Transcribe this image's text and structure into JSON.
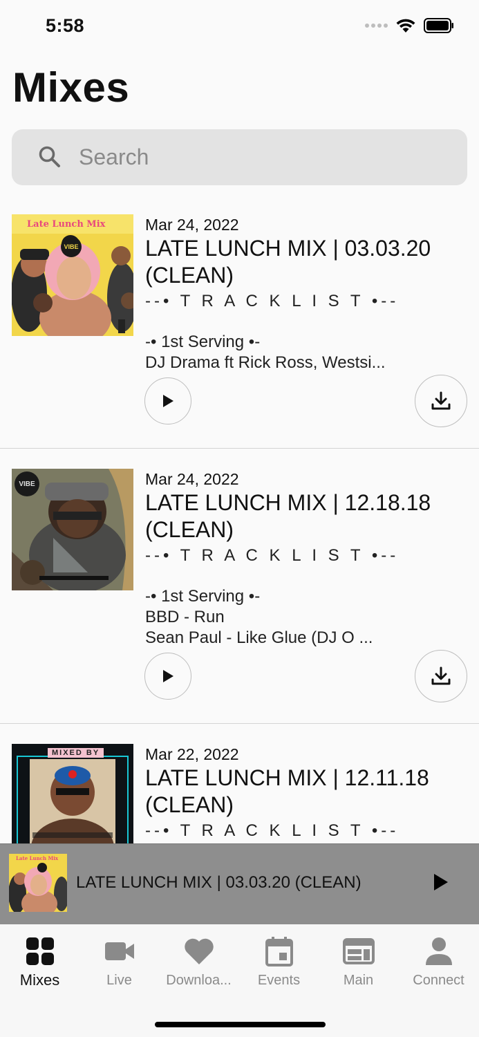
{
  "status_bar": {
    "time": "5:58"
  },
  "page": {
    "title": "Mixes"
  },
  "search": {
    "placeholder": "Search"
  },
  "mixes": [
    {
      "date": "Mar 24, 2022",
      "title": "LATE LUNCH MIX | 03.03.20 (CLEAN)",
      "tracklist": "--• T R A C K L I S T •--",
      "lines": [
        "-• 1st Serving •-",
        "DJ Drama ft Rick Ross, Westsi..."
      ],
      "cover_text": "Late Lunch Mix",
      "cover_badge": "VIBE"
    },
    {
      "date": "Mar 24, 2022",
      "title": "LATE LUNCH MIX | 12.18.18 (CLEAN)",
      "tracklist": "--• T R A C K L I S T •--",
      "lines": [
        "-• 1st Serving •-",
        "BBD - Run",
        "Sean Paul - Like Glue (DJ O ..."
      ],
      "cover_badge": "VIBE"
    },
    {
      "date": "Mar 22, 2022",
      "title": "LATE LUNCH MIX | 12.11.18 (CLEAN)",
      "tracklist": "--• T R A C K L I S T •--",
      "lines": [],
      "cover_text": "MIXED BY"
    }
  ],
  "now_playing": {
    "title": "LATE LUNCH MIX | 03.03.20 (CLEAN)",
    "cover_text": "Late Lunch Mix"
  },
  "tabs": [
    {
      "label": "Mixes",
      "icon": "grid-icon",
      "active": true
    },
    {
      "label": "Live",
      "icon": "video-camera-icon"
    },
    {
      "label": "Downloa...",
      "icon": "heart-icon"
    },
    {
      "label": "Events",
      "icon": "calendar-icon"
    },
    {
      "label": "Main",
      "icon": "browser-window-icon"
    },
    {
      "label": "Connect",
      "icon": "person-icon"
    }
  ],
  "colors": {
    "background": "#fafafa",
    "search_bg": "#e3e3e3",
    "now_playing_bg": "#8e8e8e",
    "tab_inactive": "#8a8a8a"
  }
}
